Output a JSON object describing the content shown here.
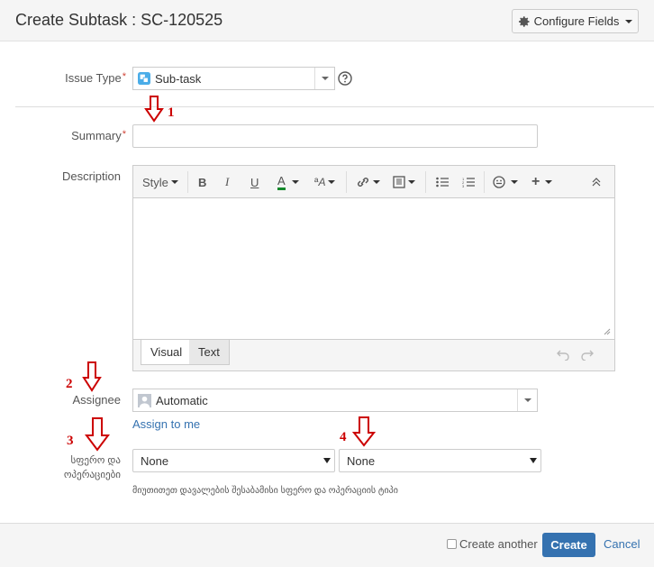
{
  "dialog": {
    "title": "Create Subtask : SC-120525",
    "configure_fields_label": "Configure Fields"
  },
  "fields": {
    "issue_type": {
      "label": "Issue Type",
      "required_mark": "*",
      "value": "Sub-task"
    },
    "summary": {
      "label": "Summary",
      "required_mark": "*",
      "value": ""
    },
    "description": {
      "label": "Description",
      "toolbar_style_label": "Style",
      "tab_visual": "Visual",
      "tab_text": "Text"
    },
    "assignee": {
      "label": "Assignee",
      "value": "Automatic",
      "assign_to_me": "Assign to me"
    },
    "sphere": {
      "label": "სფერო და ოპერაციები",
      "select1_value": "None",
      "select2_value": "None",
      "hint": "მიუთითეთ დავალების შესაბამისი სფერო და ოპერაციის ტიპი"
    }
  },
  "annotations": [
    "1",
    "2",
    "3",
    "4"
  ],
  "footer": {
    "create_another_label": "Create another",
    "create_label": "Create",
    "cancel_label": "Cancel"
  },
  "colors": {
    "primary": "#3572b0",
    "annotation": "#cc0000",
    "required": "#d04437"
  }
}
